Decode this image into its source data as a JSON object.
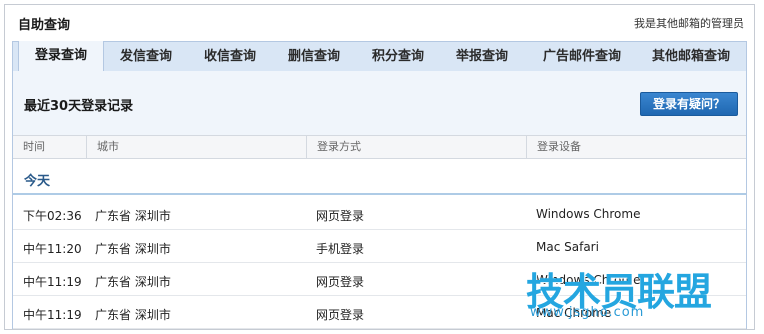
{
  "header": {
    "title": "自助查询",
    "admin_link": "我是其他邮箱的管理员"
  },
  "tabs": [
    {
      "label": "登录查询",
      "active": true
    },
    {
      "label": "发信查询"
    },
    {
      "label": "收信查询"
    },
    {
      "label": "删信查询"
    },
    {
      "label": "积分查询"
    },
    {
      "label": "举报查询"
    },
    {
      "label": "广告邮件查询"
    },
    {
      "label": "其他邮箱查询"
    }
  ],
  "section": {
    "title": "最近30天登录记录",
    "help_button": "登录有疑问？"
  },
  "table": {
    "columns": [
      "时间",
      "城市",
      "登录方式",
      "登录设备"
    ],
    "group_label": "今天",
    "rows": [
      {
        "time": "下午02:36",
        "city": "广东省 深圳市",
        "method": "网页登录",
        "device": "Windows Chrome"
      },
      {
        "time": "中午11:20",
        "city": "广东省 深圳市",
        "method": "手机登录",
        "device": "Mac Safari"
      },
      {
        "time": "中午11:19",
        "city": "广东省 深圳市",
        "method": "网页登录",
        "device": "Windows Chrome"
      },
      {
        "time": "中午11:19",
        "city": "广东省 深圳市",
        "method": "网页登录",
        "device": "Mac Chrome"
      }
    ]
  },
  "watermark": {
    "text": "技术员联盟",
    "url": "www.jsgho.com"
  },
  "colors": {
    "tab_bar": "#d9e6f5",
    "panel_bg": "#f0f5fb",
    "button": "#1f67b1",
    "watermark": "#24a6e0"
  }
}
